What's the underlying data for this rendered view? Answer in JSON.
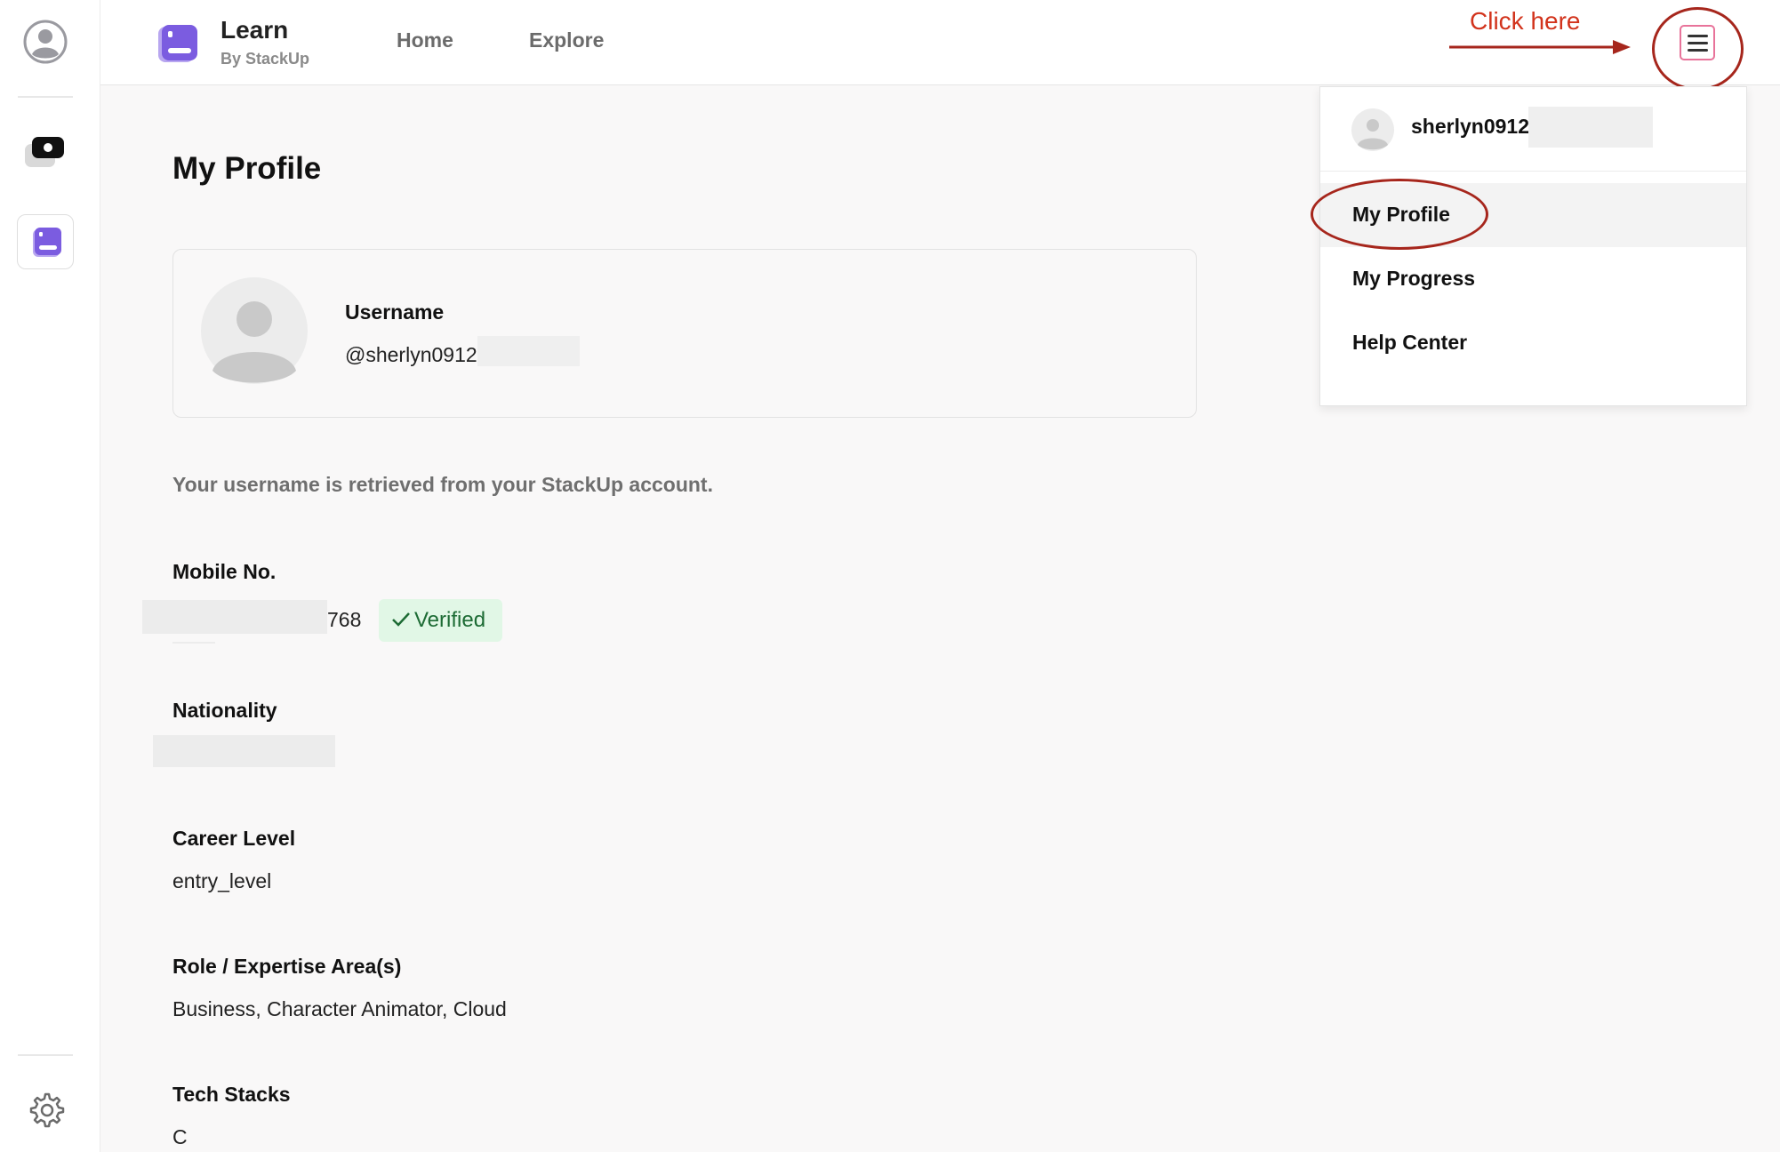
{
  "brand": {
    "title": "Learn",
    "subtitle": "By StackUp"
  },
  "nav": {
    "home": "Home",
    "explore": "Explore"
  },
  "annotation": {
    "label": "Click here",
    "color": "#d2331c"
  },
  "profile": {
    "page_title": "My Profile",
    "username_label": "Username",
    "username_value": "@sherlyn0912",
    "username_note": "Your username is retrieved from your StackUp account.",
    "mobile_label": "Mobile No.",
    "mobile_value": "768",
    "verified_label": "Verified",
    "nationality_label": "Nationality",
    "career_label": "Career Level",
    "career_value": "entry_level",
    "role_label": "Role / Expertise Area(s)",
    "role_value": "Business, Character Animator, Cloud",
    "tech_label": "Tech Stacks",
    "tech_value": "C"
  },
  "dropdown": {
    "username": "sherlyn0912",
    "items": [
      "My Profile",
      "My Progress",
      "Help Center"
    ],
    "active_index": 0
  },
  "colors": {
    "brand_purple": "#7b5ce0",
    "verified_bg": "#e1f7e6",
    "verified_text": "#1c6b34",
    "menu_border": "#e8739a"
  },
  "icons": [
    "user-avatar-icon",
    "camera-app-icon",
    "learn-app-icon",
    "settings-gear-icon",
    "hamburger-menu-icon",
    "checkmark-icon"
  ]
}
